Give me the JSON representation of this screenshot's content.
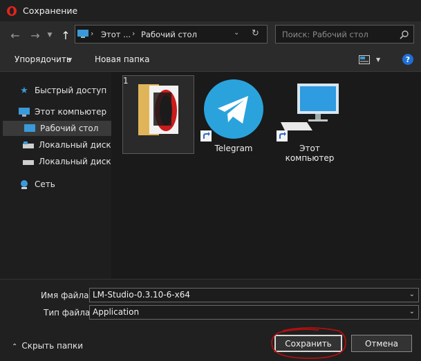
{
  "window": {
    "title": "Сохранение"
  },
  "nav": {
    "back_icon": "back-arrow-icon",
    "forward_icon": "forward-arrow-icon",
    "up_icon": "up-arrow-icon",
    "breadcrumb": [
      "Этот ...",
      "Рабочий стол"
    ],
    "search_placeholder": "Поиск: Рабочий стол"
  },
  "toolbar": {
    "organize_label": "Упорядочить",
    "new_folder_label": "Новая папка",
    "help_label": "?"
  },
  "sidebar": {
    "items": [
      {
        "label": "Быстрый доступ"
      },
      {
        "label": "Этот компьютер"
      },
      {
        "label": "Рабочий стол"
      },
      {
        "label": "Локальный диск (C"
      },
      {
        "label": "Локальный диск (D"
      },
      {
        "label": "Сеть"
      }
    ]
  },
  "files": [
    {
      "label": "1"
    },
    {
      "label": "Telegram"
    },
    {
      "label": "Этот компьютер"
    }
  ],
  "form": {
    "filename_label": "Имя файла:",
    "filename_value": "LM-Studio-0.3.10-6-x64",
    "filetype_label": "Тип файла:",
    "filetype_value": "Application"
  },
  "footer": {
    "hide_folders_label": "Скрыть папки",
    "save_label": "Сохранить",
    "cancel_label": "Отмена"
  },
  "colors": {
    "accent": "#1e6fd6",
    "annotation": "#b01010",
    "telegram": "#2aa3dc"
  }
}
